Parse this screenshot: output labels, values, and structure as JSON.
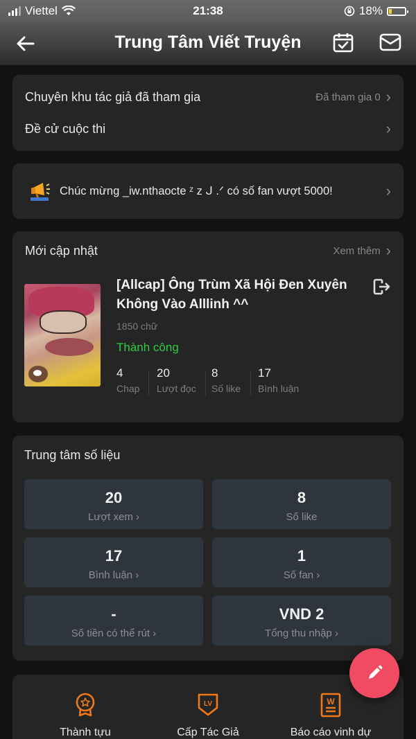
{
  "status_bar": {
    "carrier": "Viettel",
    "time": "21:38",
    "battery": "18%"
  },
  "header": {
    "title": "Trung Tâm Viết Truyện"
  },
  "menu": {
    "items": [
      {
        "label": "Chuyên khu tác giả đã tham gia",
        "value": "Đã tham gia 0"
      },
      {
        "label": "Đề cử cuộc thi",
        "value": ""
      }
    ]
  },
  "announcement": {
    "text": "Chúc mừng _iw.nthaocte ᶻ z ᒍ .ᐟ có số fan vượt 5000!"
  },
  "recent": {
    "title": "Mới cập nhật",
    "more": "Xem thêm",
    "book": {
      "title": "[Allcap] Ông Trùm Xã Hội Đen Xuyên Không Vào Alllinh ^^",
      "words": "1850 chữ",
      "status": "Thành công",
      "stats": [
        {
          "value": "4",
          "label": "Chap"
        },
        {
          "value": "20",
          "label": "Lượt đọc"
        },
        {
          "value": "8",
          "label": "Số like"
        },
        {
          "value": "17",
          "label": "Bình luận"
        }
      ]
    }
  },
  "data_center": {
    "title": "Trung tâm số liệu",
    "tiles": [
      {
        "value": "20",
        "label": "Lượt xem",
        "arrow": "›"
      },
      {
        "value": "8",
        "label": "Số like",
        "arrow": ""
      },
      {
        "value": "17",
        "label": "Bình luận",
        "arrow": "›"
      },
      {
        "value": "1",
        "label": "Số fan",
        "arrow": "›"
      },
      {
        "value": "-",
        "label": "Số tiền có thể rút",
        "arrow": "›"
      },
      {
        "value": "VND 2",
        "label": "Tổng thu nhập",
        "arrow": "›"
      }
    ]
  },
  "bottom": {
    "items": [
      {
        "label": "Thành tựu",
        "icon": "medal-icon"
      },
      {
        "label": "Cấp Tác Giả",
        "icon": "level-badge-icon",
        "badge": "LV"
      },
      {
        "label": "Báo cáo vinh dự",
        "icon": "honor-report-icon",
        "badge": "W"
      }
    ]
  },
  "colors": {
    "accent_orange": "#f07a1a",
    "success_green": "#2ecc40",
    "fab_pink": "#f04b63"
  }
}
